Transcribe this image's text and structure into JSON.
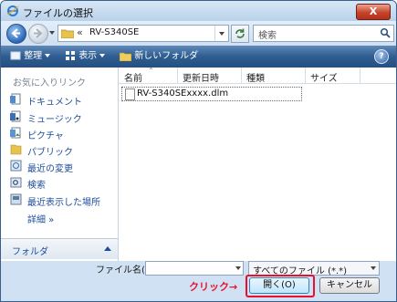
{
  "window": {
    "title": "ファイルの選択",
    "close_label": "X"
  },
  "address": {
    "chevron": "«",
    "path": "RV-S340SE"
  },
  "search": {
    "placeholder": "検索"
  },
  "toolbar": {
    "organize": "整理",
    "views": "表示",
    "new_folder": "新しいフォルダ",
    "help": "?"
  },
  "sidebar": {
    "favorites_header": "お気に入りリンク",
    "items": [
      {
        "label": "ドキュメント",
        "icon": "documents-icon"
      },
      {
        "label": "ミュージック",
        "icon": "music-icon"
      },
      {
        "label": "ピクチャ",
        "icon": "pictures-icon"
      },
      {
        "label": "パブリック",
        "icon": "public-folder-icon"
      },
      {
        "label": "最近の変更",
        "icon": "recent-changes-icon"
      },
      {
        "label": "検索",
        "icon": "search-folder-icon"
      },
      {
        "label": "最近表示した場所",
        "icon": "recent-places-icon"
      }
    ],
    "more": "詳細 »",
    "folder_bar": "フォルダ"
  },
  "columns": {
    "name": "名前",
    "date": "更新日時",
    "type": "種類",
    "size": "サイズ"
  },
  "files": [
    {
      "name": "RV-S340SExxxx.dlm"
    }
  ],
  "bottom": {
    "filename_label": "ファイル名(N):",
    "filename_value": "",
    "filetype_value": "すべてのファイル (*.*)",
    "click_annotation": "クリック→",
    "open_button": "開く(O)",
    "cancel_button": "キャンセル"
  },
  "colors": {
    "accent": "#2e5d91",
    "annotation": "#e8112d",
    "link": "#1e4e9a"
  }
}
